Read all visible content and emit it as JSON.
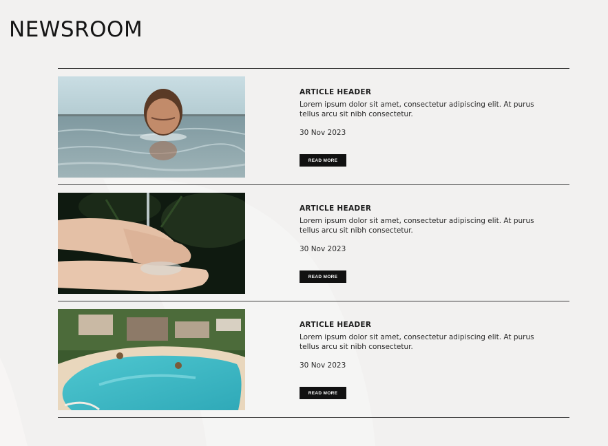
{
  "page": {
    "title": "NEWSROOM"
  },
  "articles": [
    {
      "header": "ARTICLE HEADER",
      "excerpt": "Lorem ipsum dolor sit amet, consectetur adipiscing elit. At purus tellus arcu sit nibh consectetur.",
      "date": "30 Nov 2023",
      "button_label": "READ MORE",
      "image": "swimmer-in-water-photo"
    },
    {
      "header": "ARTICLE HEADER",
      "excerpt": "Lorem ipsum dolor sit amet, consectetur adipiscing elit. At purus tellus arcu sit nibh consectetur.",
      "date": "30 Nov 2023",
      "button_label": "READ MORE",
      "image": "hands-catching-water-photo"
    },
    {
      "header": "ARTICLE HEADER",
      "excerpt": "Lorem ipsum dolor sit amet, consectetur adipiscing elit. At purus tellus arcu sit nibh consectetur.",
      "date": "30 Nov 2023",
      "button_label": "READ MORE",
      "image": "resort-pool-aerial-photo"
    }
  ],
  "colors": {
    "background": "#f2f1f0",
    "rule": "#3a3a3a",
    "button": "#111111",
    "button_text": "#ffffff"
  }
}
